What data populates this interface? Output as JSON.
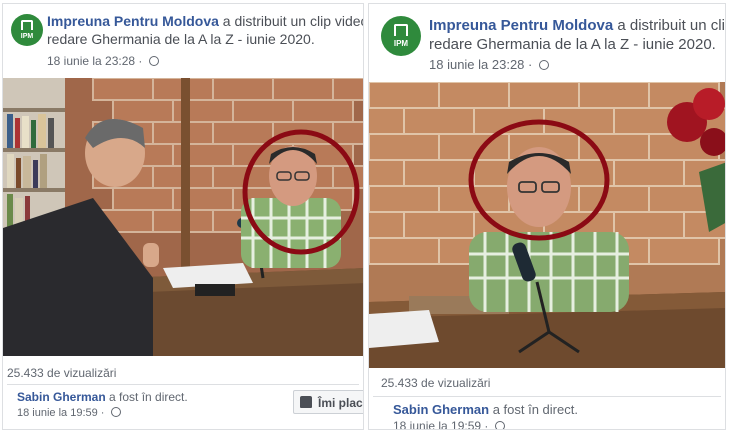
{
  "left": {
    "avatar_text": "IPM",
    "page_name": "Impreuna Pentru Moldova",
    "action_text": " a distribuit un clip video din lista d",
    "subtitle": "redare Ghermania de la A la Z - iunie 2020.",
    "timestamp": "18 iunie la 23:28 · ",
    "views": "25.433 de vizualizări",
    "live_name": "Sabin Gherman",
    "live_text": " a fost în direct.",
    "live_time": "18 iunie la 19:59 · ",
    "like_label": "Îmi place P"
  },
  "right": {
    "avatar_text": "IPM",
    "page_name": "Impreuna Pentru Moldova",
    "action_text": " a distribuit un clip",
    "subtitle": "redare Ghermania de la A la Z - iunie 2020.",
    "timestamp": "18 iunie la 23:28 · ",
    "views": "25.433 de vizualizări",
    "live_name": "Sabin Gherman",
    "live_text": " a fost în direct.",
    "live_time": "18 iunie la 19:59 · "
  },
  "colors": {
    "brand": "#2f8a3c",
    "link": "#365899",
    "highlight_circle": "#8b0a14"
  },
  "icons": {
    "globe": "globe-icon",
    "like": "thumbs-up-icon",
    "logo": "ipm-logo-icon"
  }
}
